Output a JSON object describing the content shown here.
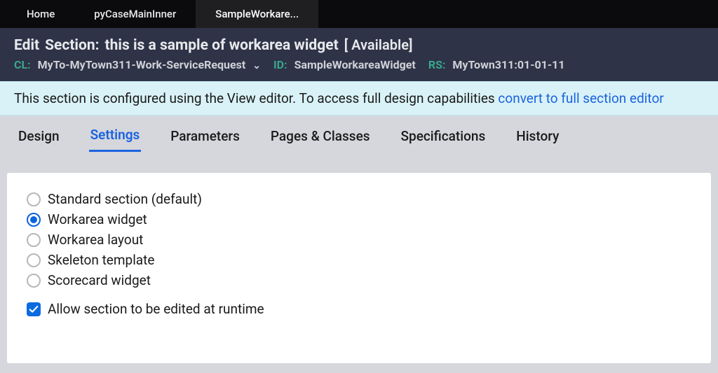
{
  "tabs": [
    {
      "label": "Home",
      "active": false
    },
    {
      "label": "pyCaseMainInner",
      "active": false
    },
    {
      "label": "SampleWorkare...",
      "active": true
    }
  ],
  "header": {
    "edit_prefix": "Edit",
    "section_label": "Section:",
    "section_name": "this is a sample of workarea widget",
    "availability": "[ Available]",
    "cl_label": "CL:",
    "cl_value": "MyTo-MyTown311-Work-ServiceRequest",
    "id_label": "ID:",
    "id_value": "SampleWorkareaWidget",
    "rs_label": "RS:",
    "rs_value": "MyTown311:01-01-11"
  },
  "banner": {
    "text": "This section is configured using the View editor. To access full design capabilities",
    "link_text": "convert to full section editor"
  },
  "subtabs": [
    {
      "label": "Design",
      "active": false
    },
    {
      "label": "Settings",
      "active": true
    },
    {
      "label": "Parameters",
      "active": false
    },
    {
      "label": "Pages & Classes",
      "active": false
    },
    {
      "label": "Specifications",
      "active": false
    },
    {
      "label": "History",
      "active": false
    }
  ],
  "settings": {
    "radios": [
      {
        "label": "Standard section (default)",
        "checked": false
      },
      {
        "label": "Workarea widget",
        "checked": true
      },
      {
        "label": "Workarea layout",
        "checked": false
      },
      {
        "label": "Skeleton template",
        "checked": false
      },
      {
        "label": "Scorecard widget",
        "checked": false
      }
    ],
    "checkbox": {
      "label": "Allow section to be edited at runtime",
      "checked": true
    }
  }
}
